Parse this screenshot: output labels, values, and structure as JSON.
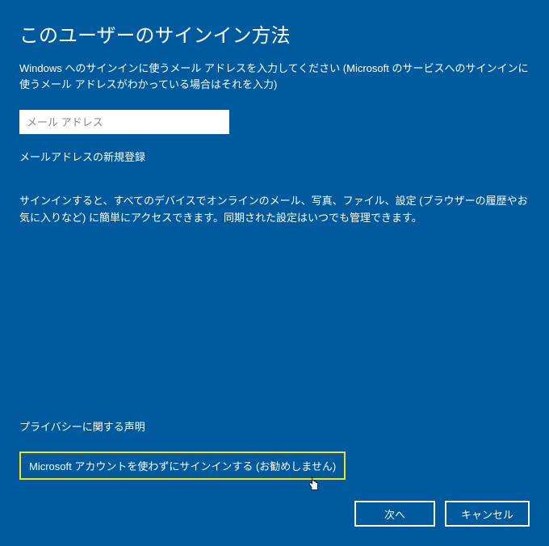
{
  "header": {
    "title": "このユーザーのサインイン方法",
    "subtitle": "Windows へのサインインに使うメール アドレスを入力してください (Microsoft のサービスへのサインインに使うメール アドレスがわかっている場合はそれを入力)"
  },
  "form": {
    "email_placeholder": "メール アドレス",
    "register_link": "メールアドレスの新規登録"
  },
  "description": "サインインすると、すべてのデバイスでオンラインのメール、写真、ファイル、設定 (ブラウザーの履歴やお気に入りなど) に簡単にアクセスできます。同期された設定はいつでも管理できます。",
  "footer": {
    "privacy_link": "プライバシーに関する声明",
    "no_account_link": "Microsoft アカウントを使わずにサインインする (お勧めしません)",
    "next_button": "次へ",
    "cancel_button": "キャンセル"
  }
}
